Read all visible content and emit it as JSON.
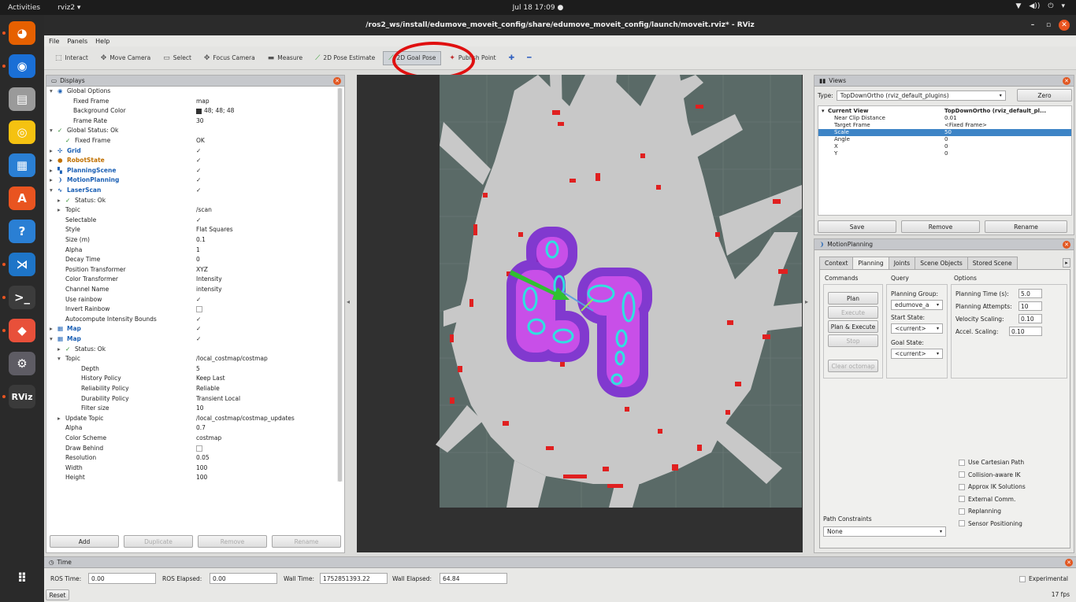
{
  "topbar": {
    "activities": "Activities",
    "app": "rviz2 ▾",
    "clock": "Jul 18  17:09  ●",
    "tray": [
      "▼",
      "◀))",
      "⏻",
      "▾"
    ]
  },
  "window": {
    "title": "/ros2_ws/install/edumove_moveit_config/share/edumove_moveit_config/launch/moveit.rviz* - RViz"
  },
  "menu": [
    "File",
    "Panels",
    "Help"
  ],
  "toolbar": {
    "tools": [
      {
        "label": "Interact",
        "icon": "⬚"
      },
      {
        "label": "Move Camera",
        "icon": "✥"
      },
      {
        "label": "Select",
        "icon": "▭"
      },
      {
        "label": "Focus Camera",
        "icon": "✥"
      },
      {
        "label": "Measure",
        "icon": "▬"
      },
      {
        "label": "2D Pose Estimate",
        "icon": "⟋"
      },
      {
        "label": "2D Goal Pose",
        "icon": "⟋"
      },
      {
        "label": "Publish Point",
        "icon": "✦"
      },
      {
        "label": "",
        "icon": "✚"
      },
      {
        "label": "",
        "icon": "━"
      }
    ]
  },
  "displays": {
    "title": "Displays",
    "rows": [
      {
        "k": "Global Options",
        "v": "",
        "indent": 1,
        "arrow": "▾",
        "icon": "◉"
      },
      {
        "k": "Fixed Frame",
        "v": "map",
        "indent": 3
      },
      {
        "k": "Background Color",
        "v": "48; 48; 48",
        "indent": 3,
        "swatch": "#303030"
      },
      {
        "k": "Frame Rate",
        "v": "30",
        "indent": 3
      },
      {
        "k": "Global Status: Ok",
        "v": "",
        "indent": 1,
        "arrow": "▾",
        "icon": "✓"
      },
      {
        "k": "Fixed Frame",
        "v": "OK",
        "indent": 2,
        "icon": "✓"
      },
      {
        "k": "Grid",
        "v": "✓",
        "indent": 1,
        "arrow": "▸",
        "icon": "✣",
        "cls": "blue"
      },
      {
        "k": "RobotState",
        "v": "✓",
        "indent": 1,
        "arrow": "▸",
        "icon": "●",
        "cls": "orange"
      },
      {
        "k": "PlanningScene",
        "v": "✓",
        "indent": 1,
        "arrow": "▸",
        "icon": "▚",
        "cls": "blue"
      },
      {
        "k": "MotionPlanning",
        "v": "✓",
        "indent": 1,
        "arrow": "▸",
        "icon": "❩",
        "cls": "blue"
      },
      {
        "k": "LaserScan",
        "v": "✓",
        "indent": 1,
        "arrow": "▾",
        "icon": "∿",
        "cls": "blue"
      },
      {
        "k": "Status: Ok",
        "v": "",
        "indent": 2,
        "arrow": "▸",
        "icon": "✓"
      },
      {
        "k": "Topic",
        "v": "/scan",
        "indent": 2,
        "arrow": "▸"
      },
      {
        "k": "Selectable",
        "v": "✓",
        "indent": 2
      },
      {
        "k": "Style",
        "v": "Flat Squares",
        "indent": 2
      },
      {
        "k": "Size (m)",
        "v": "0.1",
        "indent": 2
      },
      {
        "k": "Alpha",
        "v": "1",
        "indent": 2
      },
      {
        "k": "Decay Time",
        "v": "0",
        "indent": 2
      },
      {
        "k": "Position Transformer",
        "v": "XYZ",
        "indent": 2
      },
      {
        "k": "Color Transformer",
        "v": "Intensity",
        "indent": 2
      },
      {
        "k": "Channel Name",
        "v": "intensity",
        "indent": 2
      },
      {
        "k": "Use rainbow",
        "v": "✓",
        "indent": 2
      },
      {
        "k": "Invert Rainbow",
        "v": "",
        "indent": 2,
        "box": true
      },
      {
        "k": "Autocompute Intensity Bounds",
        "v": "✓",
        "indent": 2
      },
      {
        "k": "Map",
        "v": "✓",
        "indent": 1,
        "arrow": "▸",
        "icon": "▦",
        "cls": "blue"
      },
      {
        "k": "Map",
        "v": "✓",
        "indent": 1,
        "arrow": "▾",
        "icon": "▦",
        "cls": "blue"
      },
      {
        "k": "Status: Ok",
        "v": "",
        "indent": 2,
        "arrow": "▸",
        "icon": "✓"
      },
      {
        "k": "Topic",
        "v": "/local_costmap/costmap",
        "indent": 2,
        "arrow": "▾"
      },
      {
        "k": "Depth",
        "v": "5",
        "indent": 4
      },
      {
        "k": "History Policy",
        "v": "Keep Last",
        "indent": 4
      },
      {
        "k": "Reliability Policy",
        "v": "Reliable",
        "indent": 4
      },
      {
        "k": "Durability Policy",
        "v": "Transient Local",
        "indent": 4
      },
      {
        "k": "Filter size",
        "v": "10",
        "indent": 4
      },
      {
        "k": "Update Topic",
        "v": "/local_costmap/costmap_updates",
        "indent": 2,
        "arrow": "▸"
      },
      {
        "k": "Alpha",
        "v": "0.7",
        "indent": 2
      },
      {
        "k": "Color Scheme",
        "v": "costmap",
        "indent": 2
      },
      {
        "k": "Draw Behind",
        "v": "",
        "indent": 2,
        "box": true
      },
      {
        "k": "Resolution",
        "v": "0.05",
        "indent": 2
      },
      {
        "k": "Width",
        "v": "100",
        "indent": 2
      },
      {
        "k": "Height",
        "v": "100",
        "indent": 2
      }
    ],
    "buttons": {
      "add": "Add",
      "duplicate": "Duplicate",
      "remove": "Remove",
      "rename": "Rename"
    }
  },
  "views": {
    "title": "Views",
    "type_label": "Type:",
    "type_value": "TopDownOrtho (rviz_default_plugins)",
    "zero": "Zero",
    "current_view": {
      "k": "Current View",
      "v": "TopDownOrtho (rviz_default_pl..."
    },
    "rows": [
      {
        "k": "Near Clip Distance",
        "v": "0.01"
      },
      {
        "k": "Target Frame",
        "v": "<Fixed Frame>"
      },
      {
        "k": "Scale",
        "v": "50"
      },
      {
        "k": "Angle",
        "v": "0"
      },
      {
        "k": "X",
        "v": "0"
      },
      {
        "k": "Y",
        "v": "0"
      }
    ],
    "buttons": {
      "save": "Save",
      "remove": "Remove",
      "rename": "Rename"
    }
  },
  "motion_planning": {
    "title": "MotionPlanning",
    "tabs": [
      "Context",
      "Planning",
      "Joints",
      "Scene Objects",
      "Stored Scene"
    ],
    "commands_label": "Commands",
    "query_label": "Query",
    "options_label": "Options",
    "plan": "Plan",
    "execute": "Execute",
    "plan_execute": "Plan & Execute",
    "stop": "Stop",
    "clear_octomap": "Clear octomap",
    "planning_group_label": "Planning Group:",
    "planning_group_value": "edumove_a",
    "start_state_label": "Start State:",
    "start_state_value": "<current>",
    "goal_state_label": "Goal State:",
    "goal_state_value": "<current>",
    "planning_time_label": "Planning Time (s):",
    "planning_time_value": "5.0",
    "planning_attempts_label": "Planning Attempts:",
    "planning_attempts_value": "10",
    "velocity_label": "Velocity Scaling:",
    "velocity_value": "0.10",
    "accel_label": "Accel. Scaling:",
    "accel_value": "0.10",
    "path_constraints_label": "Path Constraints",
    "path_constraints_value": "None",
    "checkboxes": [
      "Use Cartesian Path",
      "Collision-aware IK",
      "Approx IK Solutions",
      "External Comm.",
      "Replanning",
      "Sensor Positioning"
    ]
  },
  "time": {
    "title": "Time",
    "ros_time_label": "ROS Time:",
    "ros_time": "0.00",
    "ros_elapsed_label": "ROS Elapsed:",
    "ros_elapsed": "0.00",
    "wall_time_label": "Wall Time:",
    "wall_time": "1752851393.22",
    "wall_elapsed_label": "Wall Elapsed:",
    "wall_elapsed": "64.84",
    "experimental": "Experimental",
    "reset": "Reset",
    "fps": "17 fps"
  },
  "dock": [
    {
      "name": "firefox-icon",
      "glyph": "◕",
      "bg": "#e66000"
    },
    {
      "name": "thunderbird-icon",
      "glyph": "◉",
      "bg": "#1a6fd6"
    },
    {
      "name": "files-icon",
      "glyph": "▤",
      "bg": "#9a9a9a"
    },
    {
      "name": "rhythmbox-icon",
      "glyph": "◎",
      "bg": "#f5c211"
    },
    {
      "name": "writer-icon",
      "glyph": "▦",
      "bg": "#2a7fd4"
    },
    {
      "name": "software-icon",
      "glyph": "A",
      "bg": "#e95420"
    },
    {
      "name": "help-icon",
      "glyph": "?",
      "bg": "#2a7fd4"
    },
    {
      "name": "vscode-icon",
      "glyph": "⋊",
      "bg": "#1e75c8"
    },
    {
      "name": "terminal-icon",
      "glyph": ">_",
      "bg": "#3c3c3c"
    },
    {
      "name": "git-icon",
      "glyph": "◆",
      "bg": "#e8503a"
    },
    {
      "name": "settings-icon",
      "glyph": "⚙",
      "bg": "#5e5c64"
    },
    {
      "name": "rviz-icon",
      "glyph": "RViz",
      "bg": "#3a3a3a"
    }
  ],
  "colors": {
    "accent": "#e95420",
    "selection": "#3d84c6",
    "highlight_circle": "#e01010",
    "map_free": "#c8c8c8",
    "map_unknown": "#5a6a67",
    "obstacle": "#e02020",
    "inflation": "#7a2ad0",
    "laser": "#30e0e0"
  }
}
